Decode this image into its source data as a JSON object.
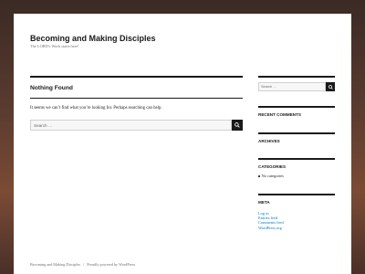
{
  "site": {
    "title": "Becoming and Making Disciples",
    "description": "The LORD's Work starts here!"
  },
  "main": {
    "page_title": "Nothing Found",
    "message": "It seems we can’t find what you’re looking for. Perhaps searching can help.",
    "search_placeholder": "Search …"
  },
  "sidebar": {
    "search_placeholder": "Search …",
    "recent_comments_title": "RECENT COMMENTS",
    "archives_title": "ARCHIVES",
    "categories_title": "CATEGORIES",
    "categories": [
      "No categories"
    ],
    "meta_title": "META",
    "meta_links": [
      "Log in",
      "Entries feed",
      "Comments feed",
      "WordPress.org"
    ]
  },
  "footer": {
    "site_name": "Becoming and Making Disciples",
    "powered_by": "Proudly powered by WordPress"
  },
  "colors": {
    "link": "#007acc",
    "text": "#1a1a1a",
    "muted": "#707070"
  }
}
